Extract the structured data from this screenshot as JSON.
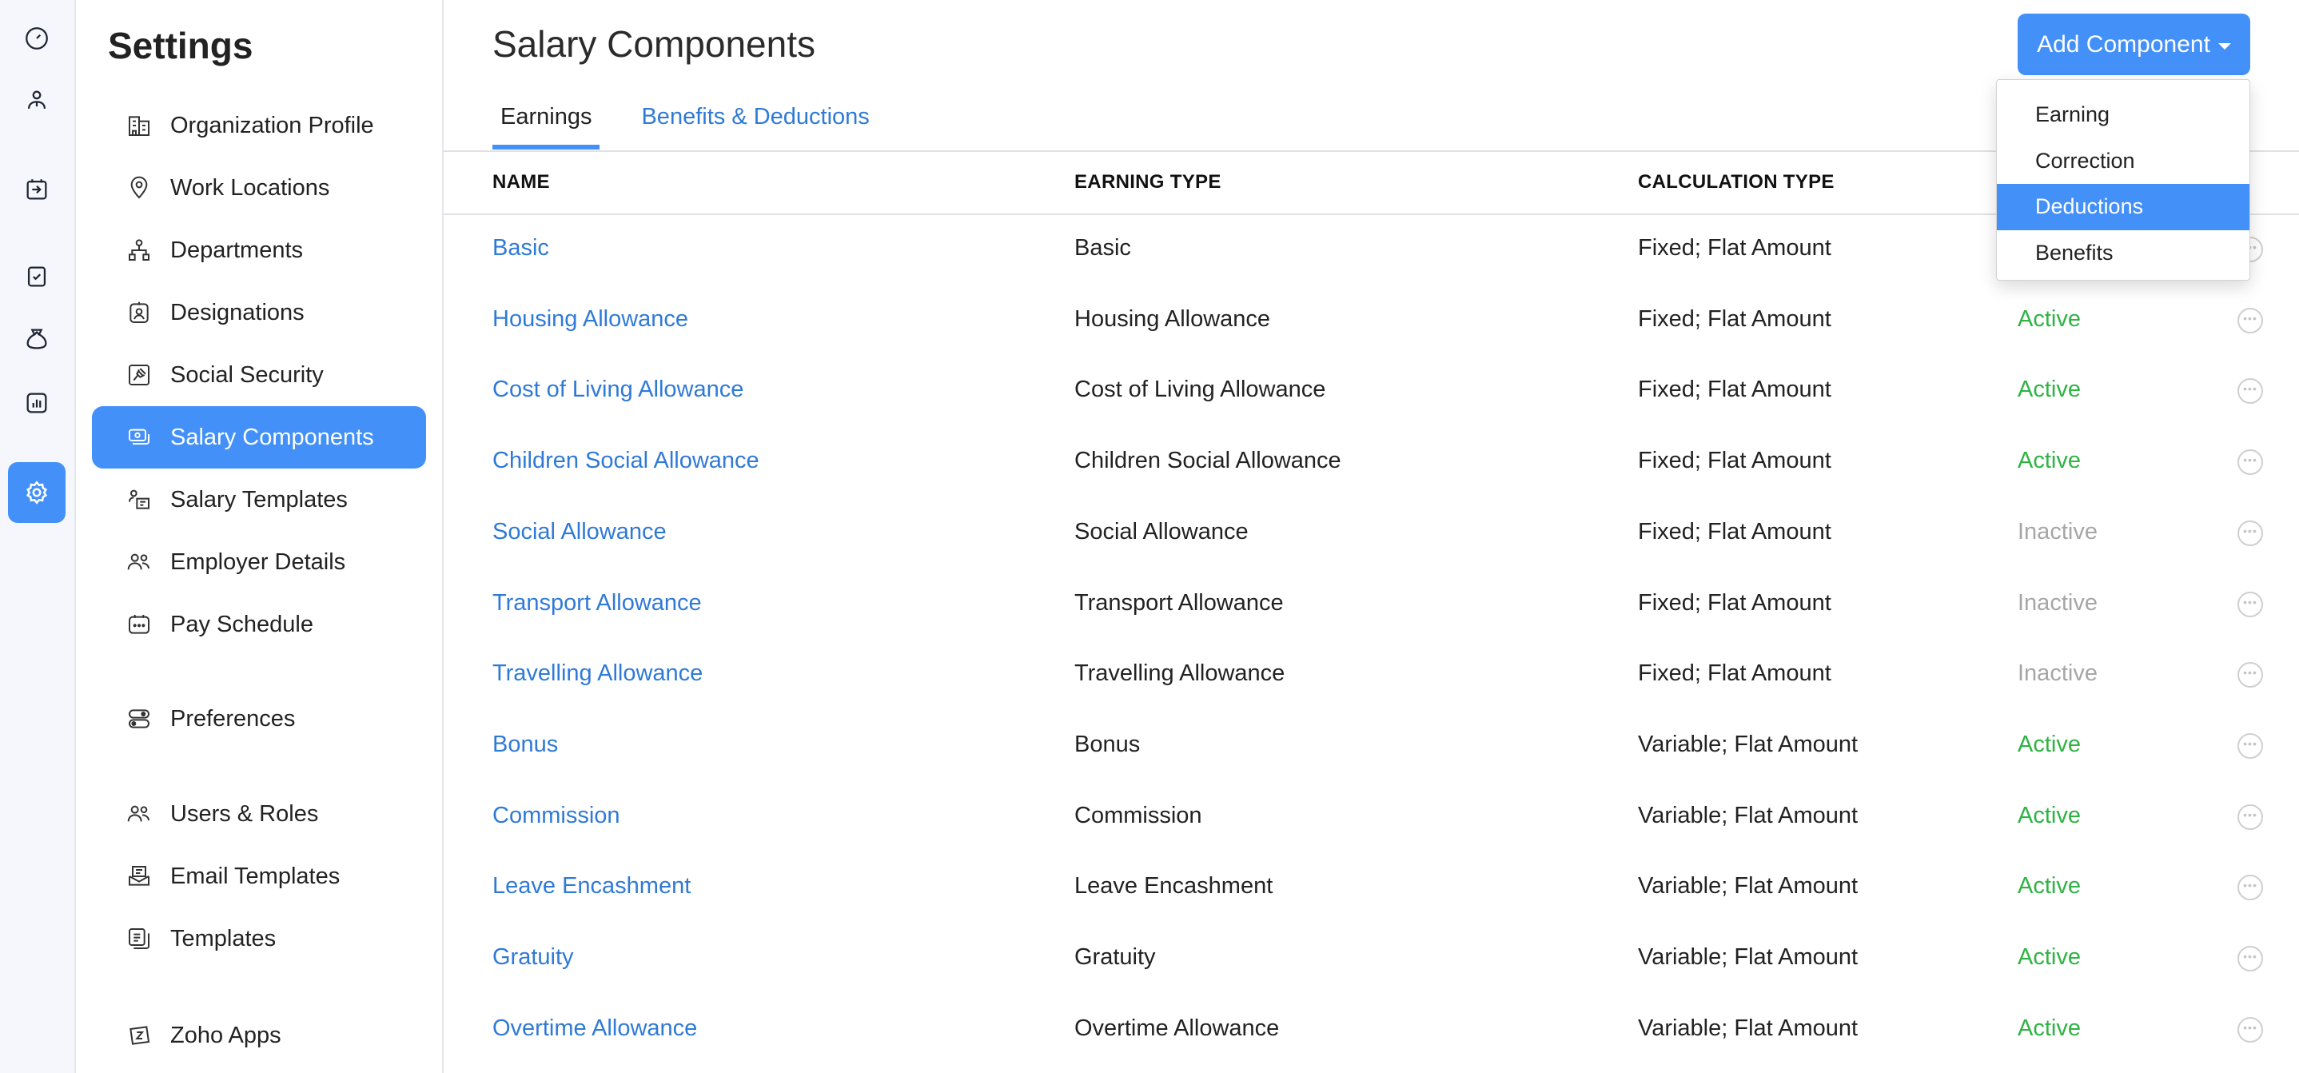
{
  "rail": {
    "items": [
      {
        "icon": "dashboard-icon"
      },
      {
        "icon": "employee-icon"
      },
      {
        "icon": "pay-runs-icon"
      },
      {
        "icon": "approvals-icon"
      },
      {
        "icon": "loans-icon"
      },
      {
        "icon": "reports-icon"
      },
      {
        "icon": "settings-gear-icon",
        "active": true
      }
    ]
  },
  "settings": {
    "title": "Settings",
    "items": [
      {
        "label": "Organization Profile",
        "icon": "building-icon"
      },
      {
        "label": "Work Locations",
        "icon": "location-pin-icon"
      },
      {
        "label": "Departments",
        "icon": "org-chart-icon"
      },
      {
        "label": "Designations",
        "icon": "id-badge-icon"
      },
      {
        "label": "Social Security",
        "icon": "gavel-icon"
      },
      {
        "label": "Salary Components",
        "icon": "money-icon",
        "active": true
      },
      {
        "label": "Salary Templates",
        "icon": "user-template-icon"
      },
      {
        "label": "Employer Details",
        "icon": "users-icon"
      },
      {
        "label": "Pay Schedule",
        "icon": "calendar-icon"
      },
      {
        "label": "Preferences",
        "icon": "toggles-icon"
      },
      {
        "label": "Users & Roles",
        "icon": "users-icon"
      },
      {
        "label": "Email Templates",
        "icon": "mail-tray-icon"
      },
      {
        "label": "Templates",
        "icon": "documents-icon"
      },
      {
        "label": "Zoho Apps",
        "icon": "zoho-icon"
      }
    ]
  },
  "header": {
    "title": "Salary Components",
    "add_button": "Add Component"
  },
  "tabs": [
    {
      "label": "Earnings",
      "active": true
    },
    {
      "label": "Benefits & Deductions",
      "active": false
    }
  ],
  "table": {
    "columns": [
      "NAME",
      "EARNING TYPE",
      "CALCULATION TYPE"
    ],
    "rows": [
      {
        "name": "Basic",
        "type": "Basic",
        "calc": "Fixed; Flat Amount",
        "status": ""
      },
      {
        "name": "Housing Allowance",
        "type": "Housing Allowance",
        "calc": "Fixed; Flat Amount",
        "status": "Active"
      },
      {
        "name": "Cost of Living Allowance",
        "type": "Cost of Living Allowance",
        "calc": "Fixed; Flat Amount",
        "status": "Active"
      },
      {
        "name": "Children Social Allowance",
        "type": "Children Social Allowance",
        "calc": "Fixed; Flat Amount",
        "status": "Active"
      },
      {
        "name": "Social Allowance",
        "type": "Social Allowance",
        "calc": "Fixed; Flat Amount",
        "status": "Inactive"
      },
      {
        "name": "Transport Allowance",
        "type": "Transport Allowance",
        "calc": "Fixed; Flat Amount",
        "status": "Inactive"
      },
      {
        "name": "Travelling Allowance",
        "type": "Travelling Allowance",
        "calc": "Fixed; Flat Amount",
        "status": "Inactive"
      },
      {
        "name": "Bonus",
        "type": "Bonus",
        "calc": "Variable; Flat Amount",
        "status": "Active"
      },
      {
        "name": "Commission",
        "type": "Commission",
        "calc": "Variable; Flat Amount",
        "status": "Active"
      },
      {
        "name": "Leave Encashment",
        "type": "Leave Encashment",
        "calc": "Variable; Flat Amount",
        "status": "Active"
      },
      {
        "name": "Gratuity",
        "type": "Gratuity",
        "calc": "Variable; Flat Amount",
        "status": "Active"
      },
      {
        "name": "Overtime Allowance",
        "type": "Overtime Allowance",
        "calc": "Variable; Flat Amount",
        "status": "Active"
      }
    ]
  },
  "dropdown": {
    "items": [
      {
        "label": "Earning"
      },
      {
        "label": "Correction"
      },
      {
        "label": "Deductions",
        "highlight": true
      },
      {
        "label": "Benefits"
      }
    ]
  },
  "colors": {
    "accent": "#4390f9",
    "link": "#2f7ad6",
    "active_status": "#2fb344",
    "inactive_status": "#a6a6a6"
  }
}
